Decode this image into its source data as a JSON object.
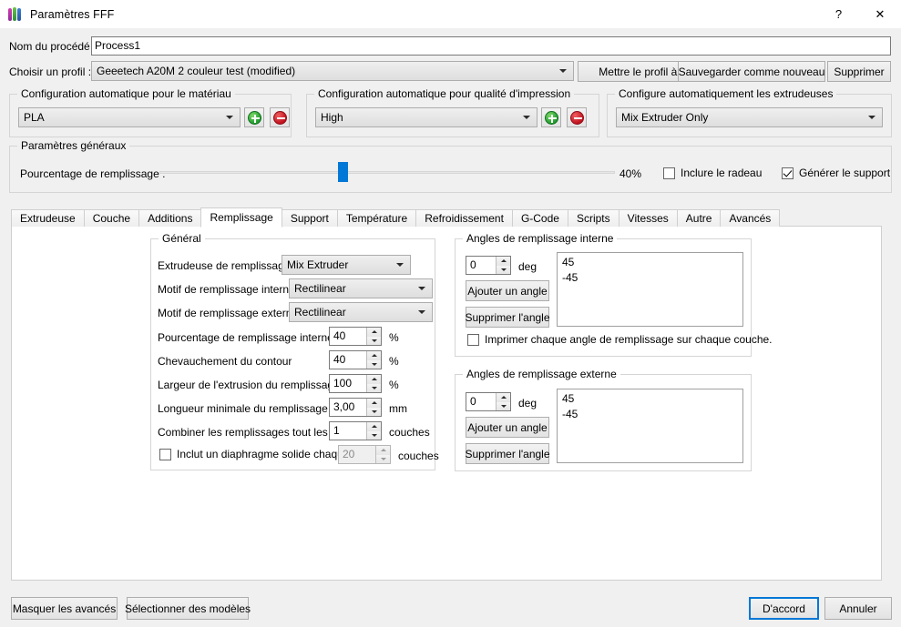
{
  "window": {
    "title": "Paramètres FFF",
    "icon": "fff-settings-icon",
    "help_label": "?",
    "close_label": "✕"
  },
  "header": {
    "process_name_label": "Nom du procédé :",
    "process_name_value": "Process1",
    "profile_label": "Choisir un profil :",
    "profile_value": "Geeetech A20M 2 couleur test (modified)",
    "update_profile_button": "Mettre le profil à jour",
    "save_as_new_button": "Sauvegarder comme nouveau",
    "delete_button": "Supprimer"
  },
  "auto_config": {
    "material": {
      "title": "Configuration automatique pour le matériau",
      "value": "PLA",
      "add_label": "+",
      "remove_label": "−"
    },
    "quality": {
      "title": "Configuration automatique pour qualité d'impression",
      "value": "High",
      "add_label": "+",
      "remove_label": "−"
    },
    "extruders": {
      "title": "Configure automatiquement les extrudeuses",
      "value": "Mix Extruder Only"
    }
  },
  "general_params": {
    "title": "Paramètres généraux",
    "infill_label": "Pourcentage de remplissage :",
    "infill_percent_text": "40%",
    "infill_percent_value": 40,
    "raft_checkbox_label": "Inclure le radeau",
    "raft_checked": false,
    "support_checkbox_label": "Générer le support",
    "support_checked": true
  },
  "tabs": [
    {
      "label": "Extrudeuse",
      "active": false
    },
    {
      "label": "Couche",
      "active": false
    },
    {
      "label": "Additions",
      "active": false
    },
    {
      "label": "Remplissage",
      "active": true
    },
    {
      "label": "Support",
      "active": false
    },
    {
      "label": "Température",
      "active": false
    },
    {
      "label": "Refroidissement",
      "active": false
    },
    {
      "label": "G-Code",
      "active": false
    },
    {
      "label": "Scripts",
      "active": false
    },
    {
      "label": "Vitesses",
      "active": false
    },
    {
      "label": "Autre",
      "active": false
    },
    {
      "label": "Avancés",
      "active": false
    }
  ],
  "infill_panel": {
    "general_group": {
      "title": "Général",
      "extruder_label": "Extrudeuse de remplissage",
      "extruder_value": "Mix Extruder",
      "internal_pattern_label": "Motif de remplissage interne",
      "internal_pattern_value": "Rectilinear",
      "external_pattern_label": "Motif de remplissage externe",
      "external_pattern_value": "Rectilinear",
      "internal_percent_label": "Pourcentage de remplissage interne",
      "internal_percent_value": "40",
      "internal_percent_unit": "%",
      "overlap_label": "Chevauchement du contour",
      "overlap_value": "40",
      "overlap_unit": "%",
      "extrusion_width_label": "Largeur de l'extrusion du remplissage",
      "extrusion_width_value": "100",
      "extrusion_width_unit": "%",
      "min_length_label": "Longueur minimale du remplissage",
      "min_length_value": "3,00",
      "min_length_unit": "mm",
      "combine_label": "Combiner les remplissages tout les",
      "combine_value": "1",
      "combine_unit": "couches",
      "diaphragm_label": "Inclut un diaphragme solide chaque",
      "diaphragm_checked": false,
      "diaphragm_value": "20",
      "diaphragm_unit": "couches"
    },
    "internal_angles_group": {
      "title": "Angles de remplissage interne",
      "angle_value": "0",
      "deg_unit": "deg",
      "add_button": "Ajouter un angle",
      "remove_button": "Supprimer l'angle",
      "angles": [
        "45",
        "-45"
      ],
      "print_each_layer_label": "Imprimer chaque angle de remplissage sur chaque couche.",
      "print_each_layer_checked": false
    },
    "external_angles_group": {
      "title": "Angles de remplissage externe",
      "angle_value": "0",
      "deg_unit": "deg",
      "add_button": "Ajouter un angle",
      "remove_button": "Supprimer l'angle",
      "angles": [
        "45",
        "-45"
      ]
    }
  },
  "footer": {
    "hide_advanced_button": "Masquer les avancés",
    "select_models_button": "Sélectionner des modèles",
    "ok_button": "D'accord",
    "cancel_button": "Annuler"
  },
  "colors": {
    "accent": "#0078d7",
    "dialog_bg": "#f0f0f0",
    "panel_bg": "#ffffff"
  }
}
